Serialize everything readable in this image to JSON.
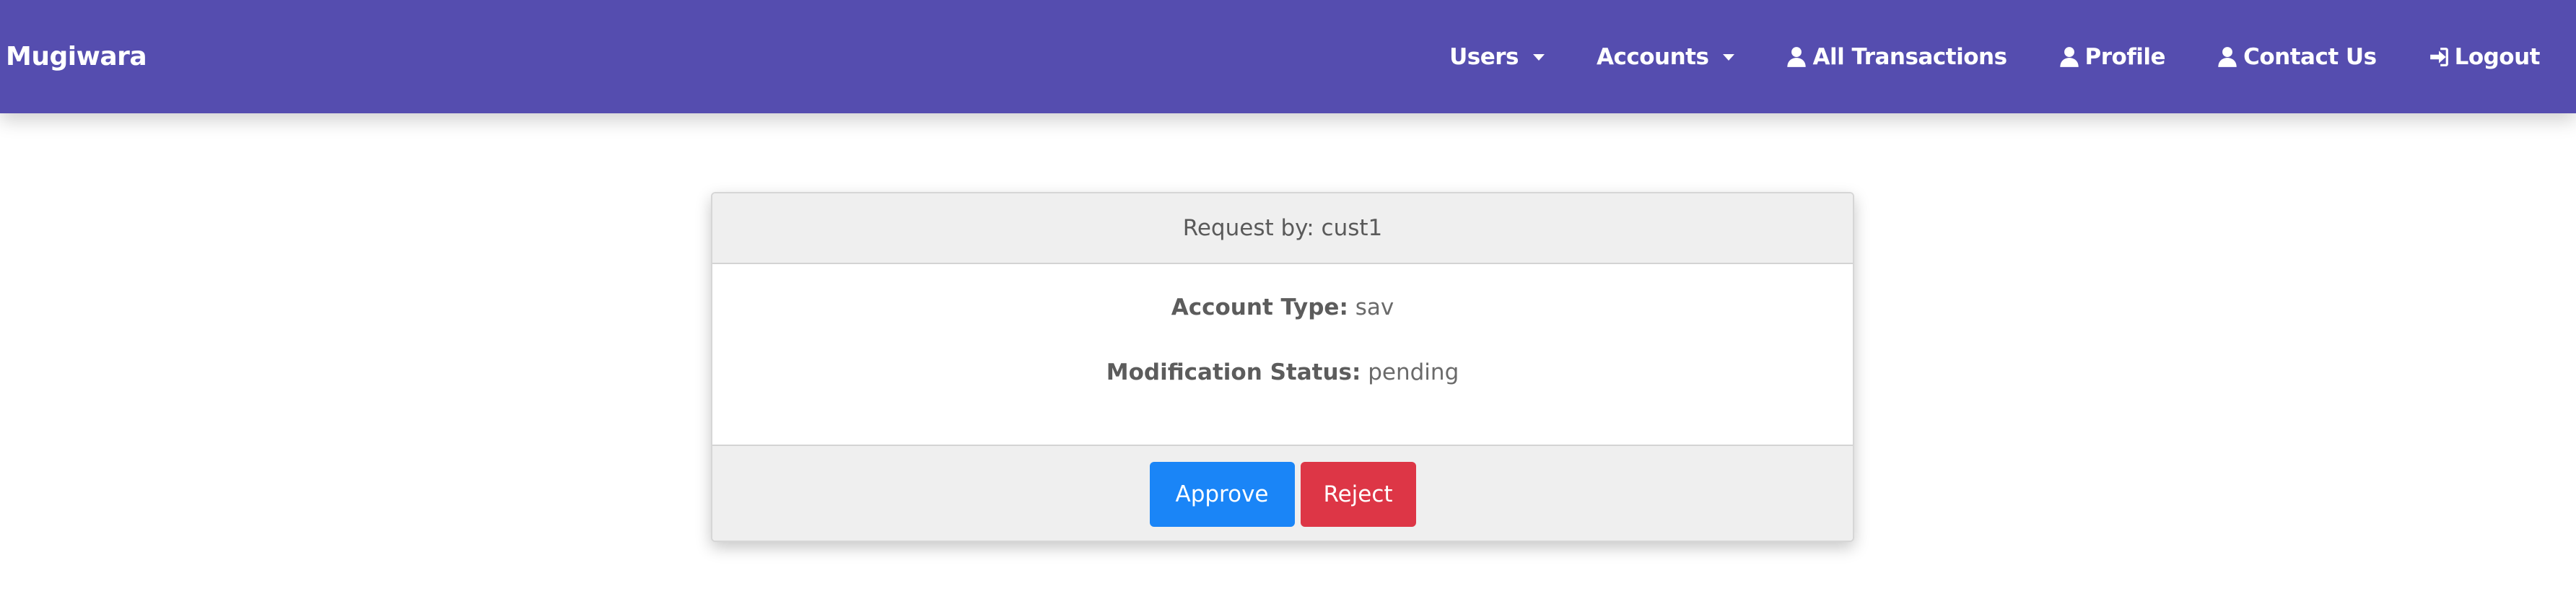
{
  "navbar": {
    "brand": "Mugiwara",
    "items": [
      {
        "label": "Users",
        "icon": "",
        "dropdown": true
      },
      {
        "label": "Accounts",
        "icon": "",
        "dropdown": true
      },
      {
        "label": "All Transactions",
        "icon": "user-icon"
      },
      {
        "label": "Profile",
        "icon": "user-icon"
      },
      {
        "label": "Contact Us",
        "icon": "user-icon"
      },
      {
        "label": "Logout",
        "icon": "sign-in-icon"
      }
    ]
  },
  "request": {
    "header": "Request by: cust1",
    "account_type_label": "Account Type:",
    "account_type_value": "sav",
    "status_label": "Modification Status:",
    "status_value": "pending"
  },
  "actions": {
    "approve": "Approve",
    "reject": "Reject"
  },
  "colors": {
    "navbar": "#554daf",
    "approve": "#1a85f7",
    "reject": "#dd3646",
    "card_header": "#efefef"
  }
}
